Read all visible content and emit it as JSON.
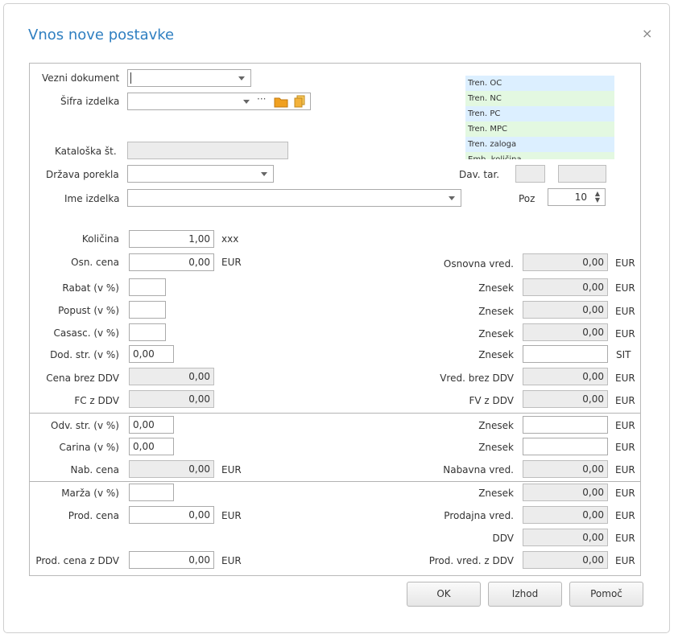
{
  "dialog": {
    "title": "Vnos nove postavke",
    "close_glyph": "×"
  },
  "info_panel": {
    "items": [
      "Tren. OC",
      "Tren. NC",
      "Tren. PC",
      "Tren. MPC",
      "Tren. zaloga",
      "Emb. količina"
    ],
    "colors": [
      "#dcefff",
      "#e3f8e1"
    ]
  },
  "top": {
    "vezni_dokument_label": "Vezni dokument",
    "sifra_izdelka_label": "Šifra izdelka",
    "sifra_ellipsis": "···",
    "kataloska_label": "Kataloška št.",
    "drzava_label": "Država porekla",
    "ime_izdelka_label": "Ime izdelka",
    "dav_tar_label": "Dav. tar.",
    "poz_label": "Poz",
    "poz_value": "10"
  },
  "left": {
    "kolicina_label": "Količina",
    "kolicina_value": "1,00",
    "kolicina_unit": "xxx",
    "osn_cena_label": "Osn. cena",
    "osn_cena_value": "0,00",
    "osn_cena_unit": "EUR",
    "rabat_label": "Rabat (v %)",
    "popust_label": "Popust (v %)",
    "casasc_label": "Casasc. (v %)",
    "dod_str_label": "Dod. str. (v %)",
    "dod_str_value": "0,00",
    "cena_brez_ddv_label": "Cena brez DDV",
    "cena_brez_ddv_value": "0,00",
    "fc_z_ddv_label": "FC z DDV",
    "fc_z_ddv_value": "0,00",
    "odv_str_label": "Odv. str. (v %)",
    "odv_str_value": "0,00",
    "carina_label": "Carina (v %)",
    "carina_value": "0,00",
    "nab_cena_label": "Nab. cena",
    "nab_cena_value": "0,00",
    "nab_cena_unit": "EUR",
    "marza_label": "Marža (v %)",
    "prod_cena_label": "Prod. cena",
    "prod_cena_value": "0,00",
    "prod_cena_unit": "EUR",
    "prod_cena_ddv_label": "Prod. cena z DDV",
    "prod_cena_ddv_value": "0,00",
    "prod_cena_ddv_unit": "EUR"
  },
  "right": {
    "osnovna_vred_label": "Osnovna vred.",
    "osnovna_vred_value": "0,00",
    "znesek_label": "Znesek",
    "znesek1_value": "0,00",
    "znesek2_value": "0,00",
    "znesek3_value": "0,00",
    "sit_unit": "SIT",
    "vred_brez_ddv_label": "Vred. brez DDV",
    "vred_brez_ddv_value": "0,00",
    "fv_z_ddv_label": "FV z DDV",
    "fv_z_ddv_value": "0,00",
    "nabavna_vred_label": "Nabavna vred.",
    "nabavna_vred_value": "0,00",
    "znesek_marza_value": "0,00",
    "prodajna_vred_label": "Prodajna vred.",
    "prodajna_vred_value": "0,00",
    "ddv_label": "DDV",
    "ddv_value": "0,00",
    "prod_vred_ddv_label": "Prod. vred. z DDV",
    "prod_vred_ddv_value": "0,00",
    "unit": "EUR"
  },
  "buttons": {
    "ok": "OK",
    "izhod": "Izhod",
    "pomoc": "Pomoč"
  }
}
